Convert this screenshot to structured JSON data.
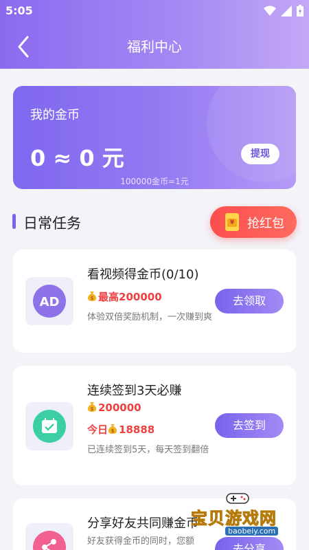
{
  "status": {
    "time": "5:05"
  },
  "header": {
    "title": "福利中心"
  },
  "coins": {
    "label": "我的金币",
    "value": "0 ≈ 0 元",
    "withdraw_label": "提现",
    "rate": "100000金币=1元"
  },
  "section": {
    "title": "日常任务",
    "redpack_label": "抢红包"
  },
  "tasks": [
    {
      "icon": "ad-icon",
      "title": "看视频得金币(0/10)",
      "reward_prefix": "最高",
      "reward": "200000",
      "desc": "体验双倍奖励机制，一次赚到爽",
      "button": "去领取"
    },
    {
      "icon": "calendar-check-icon",
      "title": "连续签到3天必赚",
      "reward": "200000",
      "today_prefix": "今日",
      "today_reward": "18888",
      "desc": "已连续签到5天，每天签到翻倍",
      "button": "去签到"
    },
    {
      "icon": "share-icon",
      "title": "分享好友共同赚金币",
      "desc": "好友获得金币的同时，您额",
      "button": "去分享"
    }
  ],
  "watermark": {
    "text": "宝贝游戏网",
    "url": "baobeiy.com"
  },
  "colors": {
    "accent": "#7a62ee",
    "reward": "#f03e3e",
    "redpack": "#fb4e4e"
  }
}
